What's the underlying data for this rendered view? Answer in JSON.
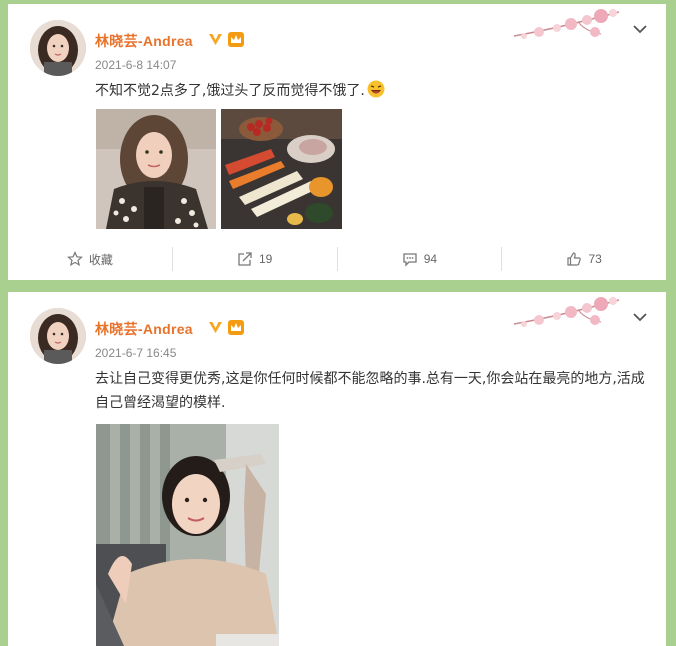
{
  "posts": [
    {
      "user": "林晓芸-Andrea",
      "time": "2021-6-8 14:07",
      "text": "不知不觉2点多了,饿过头了反而觉得不饿了.",
      "text_emoji": "laughing-emoji",
      "actions": {
        "favorite": "收藏",
        "repost": "19",
        "comment": "94",
        "like": "73"
      }
    },
    {
      "user": "林晓芸-Andrea",
      "time": "2021-6-7 16:45",
      "text": "去让自己变得更优秀,这是你任何时候都不能忽略的事.总有一天,你会站在最亮的地方,活成自己曾经渴望的模样."
    }
  ],
  "colors": {
    "background": "#a9d08e",
    "username": "#e9722b",
    "verified": "#f5a623"
  }
}
